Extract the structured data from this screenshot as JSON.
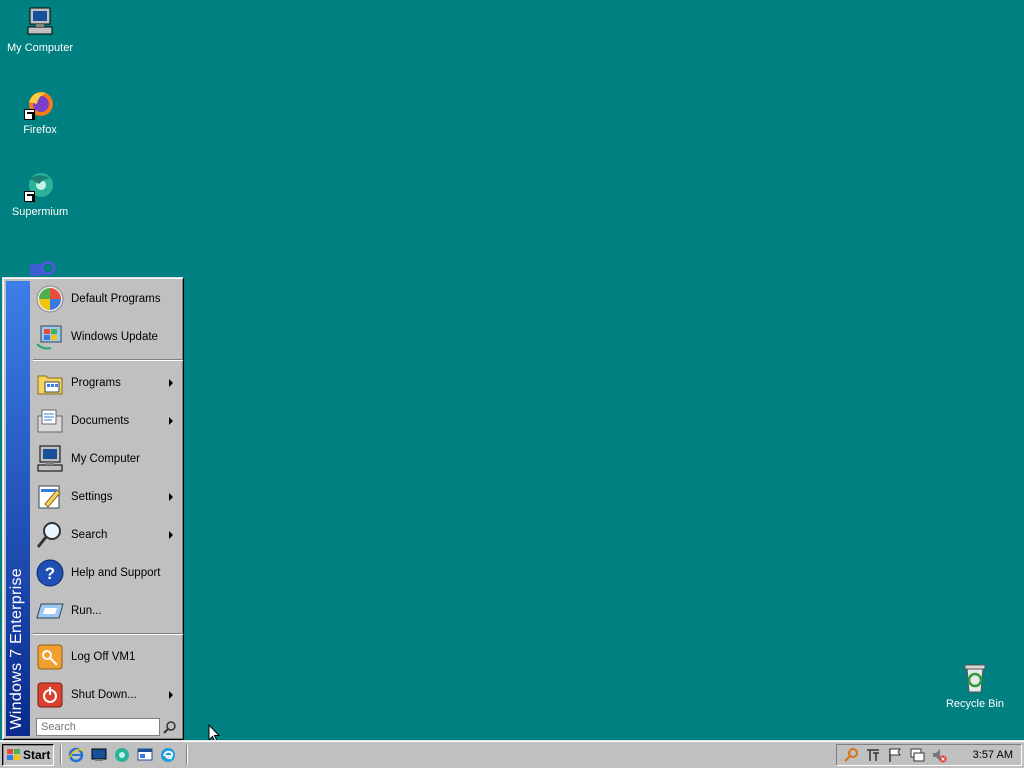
{
  "desktop": {
    "icons": [
      {
        "label": "My Computer",
        "icon": "my-computer-icon"
      },
      {
        "label": "Firefox",
        "icon": "firefox-icon"
      },
      {
        "label": "Supermium",
        "icon": "supermium-icon"
      },
      {
        "label": "Recycle Bin",
        "icon": "recycle-bin-icon"
      }
    ],
    "background_color": "#008080"
  },
  "start_menu": {
    "banner_text": "Windows 7 Enterprise",
    "top_items": [
      {
        "label": "Default Programs",
        "icon": "default-programs-icon"
      },
      {
        "label": "Windows Update",
        "icon": "windows-update-icon"
      }
    ],
    "items": [
      {
        "label": "Programs",
        "icon": "programs-icon",
        "submenu": true
      },
      {
        "label": "Documents",
        "icon": "documents-icon",
        "submenu": true
      },
      {
        "label": "My Computer",
        "icon": "my-computer-icon",
        "submenu": false
      },
      {
        "label": "Settings",
        "icon": "settings-icon",
        "submenu": true
      },
      {
        "label": "Search",
        "icon": "search-icon",
        "submenu": true
      },
      {
        "label": "Help and Support",
        "icon": "help-icon",
        "submenu": false
      },
      {
        "label": "Run...",
        "icon": "run-icon",
        "submenu": false
      }
    ],
    "bottom_items": [
      {
        "label": "Log Off VM1",
        "icon": "log-off-icon",
        "submenu": false
      },
      {
        "label": "Shut Down...",
        "icon": "shut-down-icon",
        "submenu": true
      }
    ],
    "search_placeholder": "Search"
  },
  "taskbar": {
    "start_label": "Start",
    "quick_launch": [
      "internet-explorer-icon",
      "show-desktop-icon",
      "supermium-icon",
      "window-switcher-icon",
      "edge-icon"
    ],
    "tray_icons": [
      "key-icon",
      "ime-icon",
      "flag-icon",
      "network-icon",
      "volume-muted-icon"
    ],
    "clock": "3:57 AM"
  }
}
